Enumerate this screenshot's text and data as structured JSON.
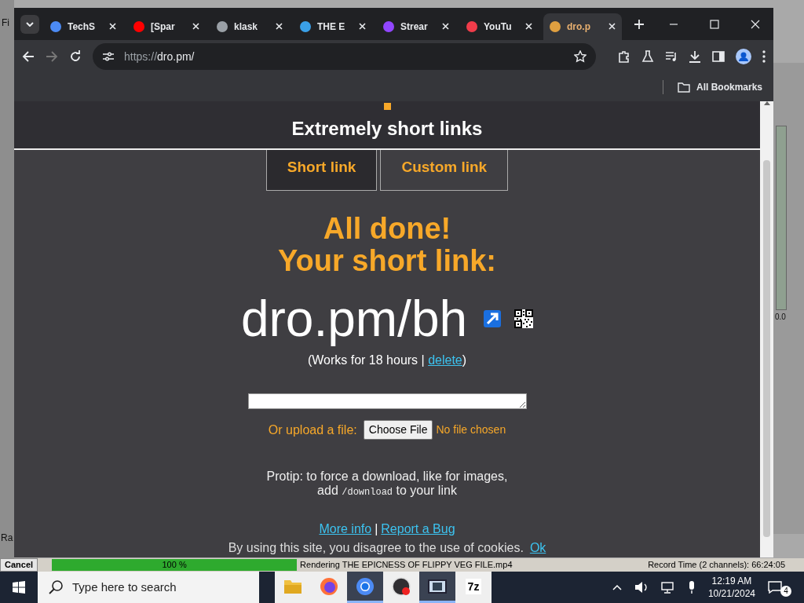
{
  "background_app": {
    "left_label": "Fi",
    "bottom_label": "Ra",
    "meter_reading": "0.0"
  },
  "browser": {
    "tabs": [
      {
        "label": "TechS",
        "selected": false,
        "color": "#4c8bf5"
      },
      {
        "label": "[Spar",
        "selected": false,
        "color": "#ff0000"
      },
      {
        "label": "klask",
        "selected": false,
        "color": "#9aa0a6"
      },
      {
        "label": "THE E",
        "selected": false,
        "color": "#3aa0e8"
      },
      {
        "label": "Strear",
        "selected": false,
        "color": "#9146ff"
      },
      {
        "label": "YouTu",
        "selected": false,
        "color": "#f03c4a"
      },
      {
        "label": "dro.p",
        "selected": true,
        "color": "#e0a040"
      }
    ],
    "url_scheme": "https://",
    "url_host": "dro.pm/",
    "bookmarks": [
      "All Bookmarks"
    ]
  },
  "page": {
    "title": "Extremely short links",
    "modes": [
      {
        "label": "Short link",
        "selected": true
      },
      {
        "label": "Custom link",
        "selected": false
      }
    ],
    "heading_lines": [
      "All done!",
      "Your short link:"
    ],
    "short_link": "dro.pm/bh",
    "validity": {
      "before": "(Works for 18 hours | ",
      "link": "delete",
      "after": ")"
    },
    "upload": {
      "label": "Or upload a file:",
      "button": "Choose File",
      "status": "No file chosen"
    },
    "protip": {
      "line1": "Protip: to force a download, like for images,",
      "before": "add ",
      "code": "/download",
      "after": " to your link"
    },
    "footer_links": [
      "More info",
      "Report a Bug"
    ],
    "footer_separator": "|",
    "cookie": {
      "text": "By using this site, you disagree to the use of cookies.",
      "link": "Ok"
    }
  },
  "render_status": {
    "cancel": "Cancel",
    "progress": {
      "level": 1,
      "reading": "100 %"
    },
    "message": "Rendering THE EPICNESS OF FLIPPY VEG FILE.mp4",
    "record_time": "Record Time (2 channels): 66:24:05"
  },
  "taskbar": {
    "search_placeholder": "Type here to search",
    "apps": [
      {
        "kind": "folder",
        "selected": false
      },
      {
        "kind": "firefox",
        "selected": false
      },
      {
        "kind": "chrome",
        "selected": true
      },
      {
        "kind": "obs",
        "selected": false
      },
      {
        "kind": "film",
        "selected": true
      },
      {
        "kind": "sevenzip",
        "label": "7z",
        "selected": false
      }
    ],
    "time": "12:19 AM",
    "date": "10/21/2024",
    "notifications": "4"
  }
}
